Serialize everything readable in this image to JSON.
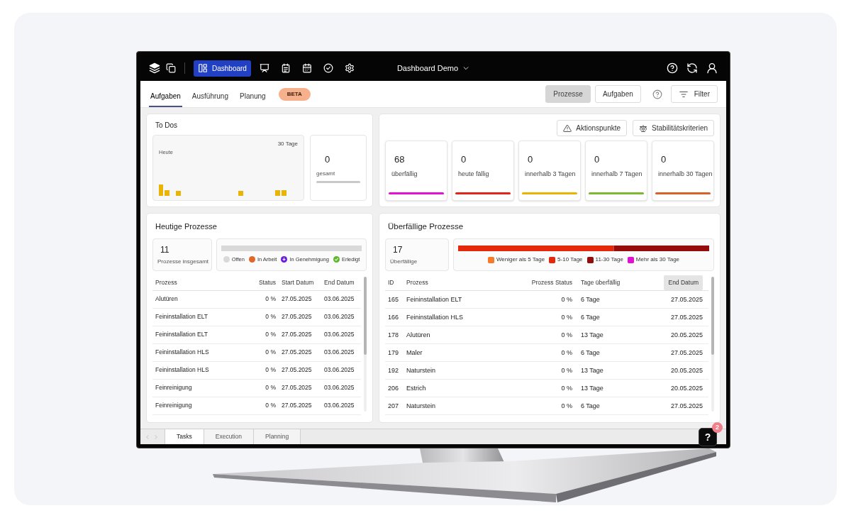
{
  "header": {
    "title": "Dashboard Demo",
    "nav": [
      {
        "label": "Dashboard",
        "selected": true
      },
      {
        "selected": false
      },
      {
        "selected": false
      },
      {
        "selected": false
      },
      {
        "selected": false
      },
      {
        "selected": false
      }
    ]
  },
  "tabs": [
    {
      "label": "Aufgaben",
      "selected": true
    },
    {
      "label": "Ausführung",
      "selected": false
    },
    {
      "label": "Planung",
      "selected": false
    }
  ],
  "badge": "BETA",
  "view_toggle": [
    {
      "label": "Prozesse",
      "selected": true
    },
    {
      "label": "Aufgaben",
      "selected": false
    }
  ],
  "filter_button": "Filter",
  "actions": [
    "Aktionspunkte",
    "Stabilitätskriterien"
  ],
  "todos": {
    "title": "To Dos",
    "start_label": "Heute",
    "end_label": "30 Tage",
    "total": {
      "value": "0",
      "label": "gesamt"
    }
  },
  "stats": [
    {
      "value": "68",
      "label": "überfällig",
      "color": "#e312d3"
    },
    {
      "value": "0",
      "label": "heute fällig",
      "color": "#e1251b"
    },
    {
      "value": "0",
      "label": "innerhalb 3 Tagen",
      "color": "#e9b404"
    },
    {
      "value": "0",
      "label": "innerhalb 7 Tagen",
      "color": "#7cb832"
    },
    {
      "value": "0",
      "label": "innerhalb 30 Tagen",
      "color": "#d9622b"
    }
  ],
  "today": {
    "title": "Heutige Prozesse",
    "count": "11",
    "count_label": "Prozesse insgesamt",
    "legend": [
      {
        "label": "Offen",
        "kind": "dot",
        "color": "#d9d9d9"
      },
      {
        "label": "In Arbeit",
        "kind": "dot",
        "color": "#e0662a"
      },
      {
        "label": "In Genehmigung",
        "kind": "pending",
        "color": "#6a1be0"
      },
      {
        "label": "Erledigt",
        "kind": "done",
        "color": "#5cb82a"
      }
    ],
    "columns": [
      "Prozess",
      "Status",
      "Start Datum",
      "End Datum"
    ],
    "rows": [
      [
        "Alutüren",
        "0 %",
        "27.05.2025",
        "03.06.2025"
      ],
      [
        "Feininstallation ELT",
        "0 %",
        "27.05.2025",
        "03.06.2025"
      ],
      [
        "Feininstallation ELT",
        "0 %",
        "27.05.2025",
        "03.06.2025"
      ],
      [
        "Feininstallation HLS",
        "0 %",
        "27.05.2025",
        "03.06.2025"
      ],
      [
        "Feininstallation HLS",
        "0 %",
        "27.05.2025",
        "03.06.2025"
      ],
      [
        "Feinreinigung",
        "0 %",
        "27.05.2025",
        "03.06.2025"
      ],
      [
        "Feinreinigung",
        "0 %",
        "27.05.2025",
        "03.06.2025"
      ]
    ]
  },
  "overdue": {
    "title": "Überfällige Prozesse",
    "count": "17",
    "count_label": "Überfällige",
    "legend": [
      {
        "label": "Weniger als 5 Tage",
        "color": "#f7792a"
      },
      {
        "label": "5-10 Tage",
        "color": "#e5270b"
      },
      {
        "label": "11-30 Tage",
        "color": "#960c0c"
      },
      {
        "label": "Mehr als 30 Tage",
        "color": "#e00fd2"
      }
    ],
    "columns": [
      {
        "label": "ID",
        "sorted": false
      },
      {
        "label": "Prozess",
        "sorted": false
      },
      {
        "label": "Prozess Status",
        "sorted": false
      },
      {
        "label": "Tage überfällig",
        "sorted": false
      },
      {
        "label": "End Datum",
        "sorted": true
      }
    ],
    "rows": [
      [
        "165",
        "Feininstallation ELT",
        "0 %",
        "6 Tage",
        "27.05.2025"
      ],
      [
        "166",
        "Feininstallation HLS",
        "0 %",
        "6 Tage",
        "27.05.2025"
      ],
      [
        "178",
        "Alutüren",
        "0 %",
        "13 Tage",
        "20.05.2025"
      ],
      [
        "179",
        "Maler",
        "0 %",
        "6 Tage",
        "27.05.2025"
      ],
      [
        "192",
        "Naturstein",
        "0 %",
        "13 Tage",
        "20.05.2025"
      ],
      [
        "206",
        "Estrich",
        "0 %",
        "13 Tage",
        "20.05.2025"
      ],
      [
        "207",
        "Naturstein",
        "0 %",
        "6 Tage",
        "27.05.2025"
      ]
    ]
  },
  "sheet_tabs": [
    {
      "label": "Tasks",
      "selected": true
    },
    {
      "label": "Execution",
      "selected": false
    },
    {
      "label": "Planning",
      "selected": false
    }
  ],
  "help_button": {
    "label": "?",
    "badge": "2"
  }
}
